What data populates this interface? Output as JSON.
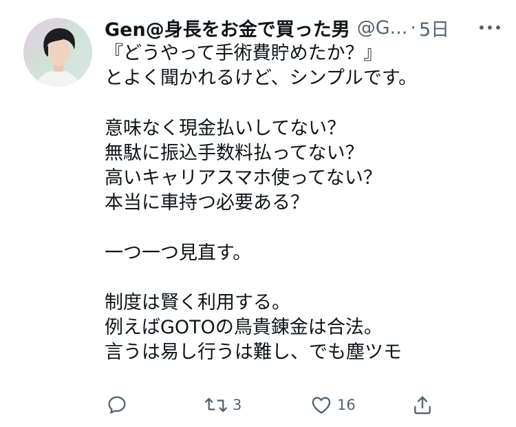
{
  "tweet": {
    "author": {
      "display_name": "Gen@身長をお金で買った男",
      "handle": "@G...",
      "avatar_icon": "profile-photo"
    },
    "separator": "·",
    "time": "5日",
    "more_icon": "more-horizontal-icon",
    "lines": [
      "『どうやって手術費貯めたか？』",
      "とよく聞かれるけど、シンプルです。",
      "",
      "意味なく現金払いしてない？",
      "無駄に振込手数料払ってない？",
      "高いキャリアスマホ使ってない？",
      "本当に車持つ必要ある？",
      "",
      "一つ一つ見直す。",
      "",
      "制度は賢く利用する。",
      "例えばGOTOの鳥貴錬金は合法。",
      "言うは易し行うは難し、でも塵ツモ"
    ],
    "actions": {
      "reply": {
        "icon": "reply-icon",
        "count": ""
      },
      "retweet": {
        "icon": "retweet-icon",
        "count": "3"
      },
      "like": {
        "icon": "heart-icon",
        "count": "16"
      },
      "share": {
        "icon": "share-icon",
        "count": ""
      }
    },
    "colors": {
      "text": "#0f1419",
      "secondary": "#536471",
      "background": "#ffffff"
    }
  }
}
